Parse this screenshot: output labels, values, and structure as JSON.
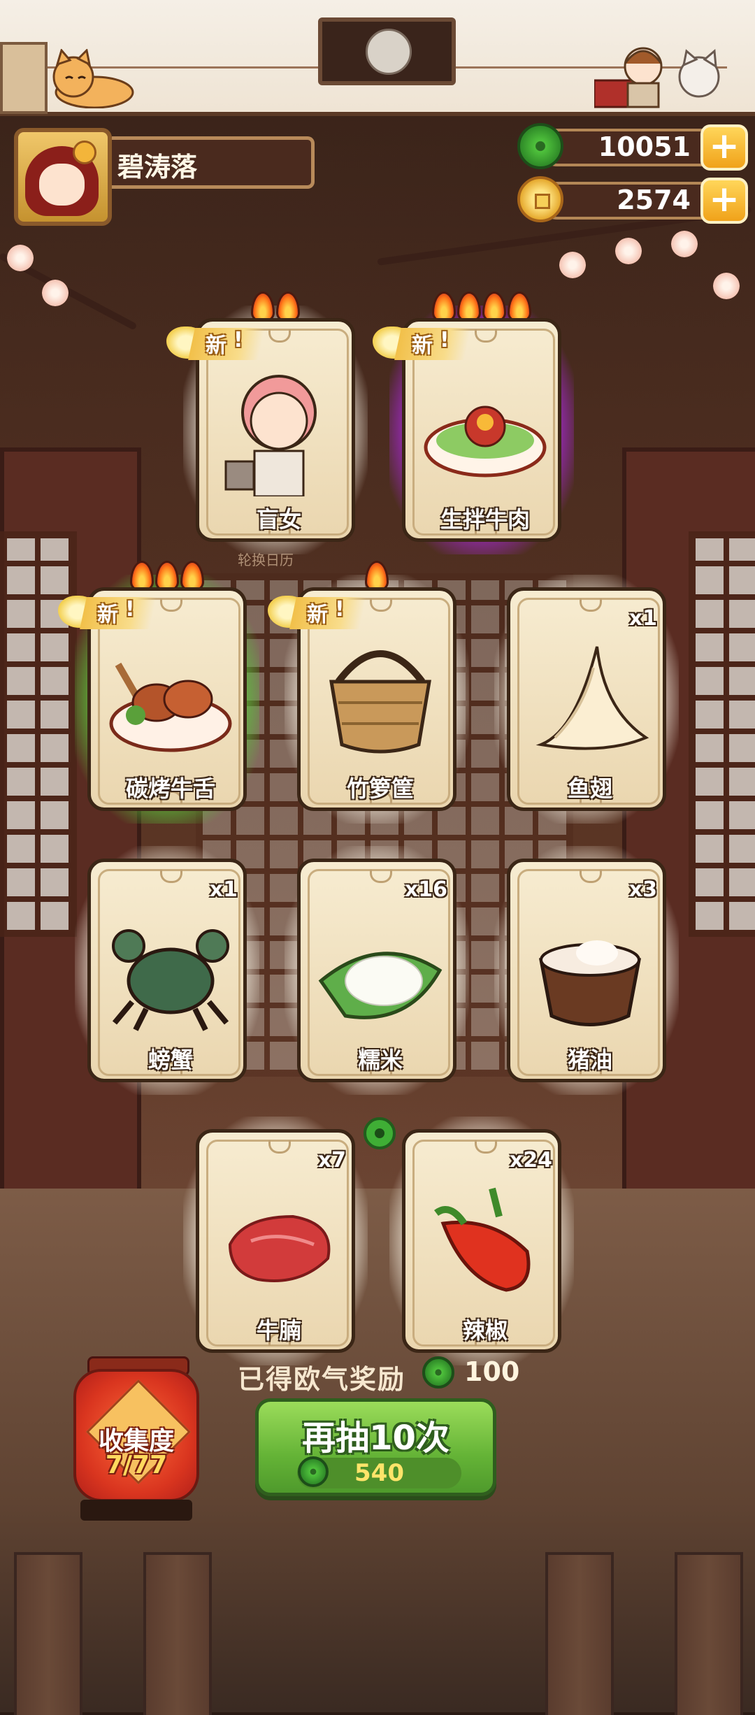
{
  "header": {
    "player_name": "碧涛落"
  },
  "currencies": [
    {
      "icon": "jade-coin-icon",
      "value": "10051"
    },
    {
      "icon": "gold-coin-icon",
      "value": "2574"
    }
  ],
  "calendar_label": "轮换日历",
  "cards": [
    {
      "name": "盲女",
      "new": true,
      "new_label": "新",
      "flames": 2,
      "count": "",
      "rarity": "white"
    },
    {
      "name": "生拌牛肉",
      "new": true,
      "new_label": "新",
      "flames": 4,
      "count": "",
      "rarity": "purple"
    },
    {
      "name": "碳烤牛舌",
      "new": true,
      "new_label": "新",
      "flames": 3,
      "count": "",
      "rarity": "green"
    },
    {
      "name": "竹箩筐",
      "new": true,
      "new_label": "新",
      "flames": 1,
      "count": "",
      "rarity": "white"
    },
    {
      "name": "鱼翅",
      "new": false,
      "flames": 0,
      "count": "x1",
      "rarity": "white"
    },
    {
      "name": "螃蟹",
      "new": false,
      "flames": 0,
      "count": "x1",
      "rarity": "white"
    },
    {
      "name": "糯米",
      "new": false,
      "flames": 0,
      "count": "x16",
      "rarity": "white"
    },
    {
      "name": "猪油",
      "new": false,
      "flames": 0,
      "count": "x3",
      "rarity": "white"
    },
    {
      "name": "牛腩",
      "new": false,
      "flames": 0,
      "count": "x7",
      "rarity": "white"
    },
    {
      "name": "辣椒",
      "new": false,
      "flames": 0,
      "count": "x24",
      "rarity": "white"
    }
  ],
  "reward": {
    "label": "已得欧气奖励",
    "value": "100"
  },
  "collection": {
    "title": "收集度",
    "progress": "7/77"
  },
  "draw_button": {
    "label": "再抽10次",
    "cost": "540"
  },
  "colors": {
    "accent_green": "#64b336",
    "glow_purple": "#e25cff",
    "glow_green": "#a0ff6e",
    "gold": "#f0a21a"
  }
}
